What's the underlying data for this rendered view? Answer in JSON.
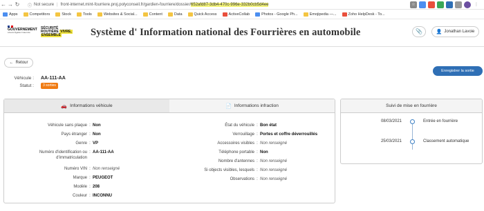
{
  "browser": {
    "security_label": "Not secure",
    "url_prefix": "front-internet.mint-fourriere.proj.polyconseil.fr/gardien-fourriere/dossier/",
    "url_highlight": "652afd87-3db4-470c-996e-332b0cb5d4ee"
  },
  "bookmarks": [
    "Apps",
    "Competitors",
    "Stock",
    "Tools",
    "Websites & Social...",
    "Content",
    "Data",
    "Quick Access",
    "ActiveCollab",
    "Photos - Google Ph...",
    "Emojipedia —...",
    "Zoho HelpDesk - To..."
  ],
  "header": {
    "gov_name": "GOUVERNEMENT",
    "gov_motto": "Liberté Égalité Fraternité",
    "sec_line1": "SÉCURITÉ",
    "sec_line2": "ROUTIÈRE",
    "sec_line3": "VIVRE,",
    "sec_line4": "ENSEMBLE",
    "title": "Système d' Information national des Fourrières en automobile",
    "user_name": "Jonathan Lavoie"
  },
  "back_label": "Retour",
  "vehicle": {
    "vehicle_label": "Véhicule :",
    "plate": "AA-111-AA",
    "status_label": "Statut :",
    "status_badge": "3 sorties"
  },
  "exit_button": "Enregistrer la sortie",
  "tabs": {
    "vehicle": "Informations véhicule",
    "infraction": "Informations infraction"
  },
  "vehicle_info": [
    {
      "label": "Véhicule sans plaque",
      "value": "Non",
      "style": "b"
    },
    {
      "label": "Pays étranger",
      "value": "Non",
      "style": "b"
    },
    {
      "label": "Genre",
      "value": "VP",
      "style": "b"
    },
    {
      "label": "Numéro d'identification ou d'immatriculation",
      "value": "AA-111-AA",
      "style": "b"
    },
    {
      "label": "Numéro VIN",
      "value": "Non renseigné",
      "style": "i"
    },
    {
      "label": "Marque",
      "value": "PEUGEOT",
      "style": "b"
    },
    {
      "label": "Modèle",
      "value": "208",
      "style": "b"
    },
    {
      "label": "Couleur",
      "value": "INCONNU",
      "style": "b"
    }
  ],
  "infraction_info": [
    {
      "label": "État du véhicule",
      "value": "Bon état",
      "style": "b"
    },
    {
      "label": "Verrouillage",
      "value": "Portes et coffre déverrouillés",
      "style": "b"
    },
    {
      "label": "Accessoires visibles",
      "value": "Non renseigné",
      "style": "i"
    },
    {
      "label": "Téléphone portable",
      "value": "Non",
      "style": "b"
    },
    {
      "label": "Nombre d'antennes",
      "value": "Non renseigné",
      "style": "i"
    },
    {
      "label": "Si objects visibles, lesquels",
      "value": "Non renseigné",
      "style": "i"
    },
    {
      "label": "Observations",
      "value": "Non renseigné",
      "style": "i"
    }
  ],
  "timeline": {
    "title": "Suivi de mise en fourrière",
    "events": [
      {
        "date": "08/03/2021",
        "text": "Entrée en fourrière"
      },
      {
        "date": "25/03/2021",
        "text": "Classement automatique"
      }
    ]
  },
  "colors": {
    "accent": "#2f6fb5",
    "badge": "#f07b12",
    "url_highlight": "#f2f27a"
  }
}
